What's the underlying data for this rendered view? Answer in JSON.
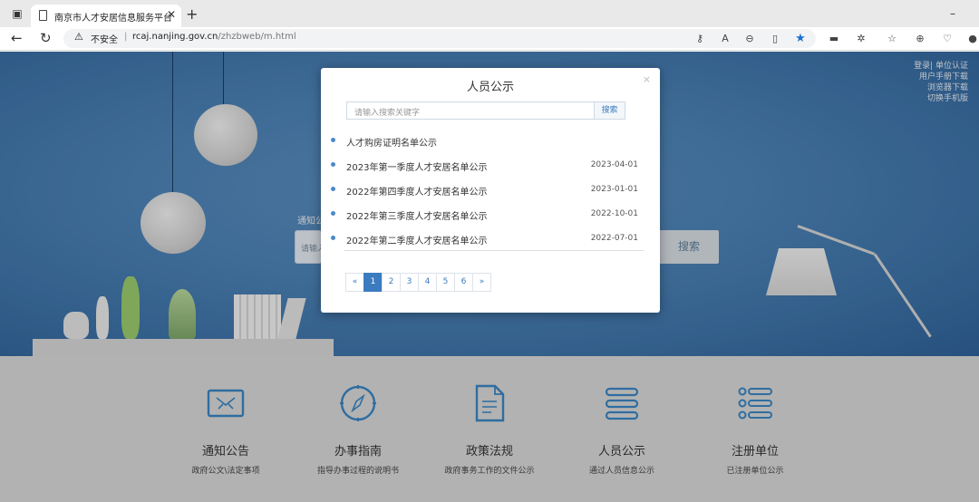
{
  "browser": {
    "tab_title": "南京市人才安居信息服务平台",
    "new_tab": "+",
    "security_label": "不安全",
    "url_host": "rcaj.nanjing.gov.cn",
    "url_path": "/zhzbweb/m.html",
    "separator": "|"
  },
  "top_links": [
    "登录| 单位认证",
    "用户手册下载",
    "浏览器下载",
    "切换手机版"
  ],
  "hero": {
    "search_hint": "通知公",
    "search_placeholder": "请输入",
    "search_button": "搜索"
  },
  "modal": {
    "title": "人员公示",
    "close": "×",
    "search_placeholder": "请输入搜索关键字",
    "search_button": "搜索",
    "items": [
      {
        "title": "人才购房证明名单公示",
        "date": ""
      },
      {
        "title": "2023年第一季度人才安居名单公示",
        "date": "2023-04-01"
      },
      {
        "title": "2022年第四季度人才安居名单公示",
        "date": "2023-01-01"
      },
      {
        "title": "2022年第三季度人才安居名单公示",
        "date": "2022-10-01"
      },
      {
        "title": "2022年第二季度人才安居名单公示",
        "date": "2022-07-01"
      }
    ],
    "pager": {
      "prev": "«",
      "pages": [
        "1",
        "2",
        "3",
        "4",
        "5",
        "6"
      ],
      "next": "»",
      "current": "1"
    }
  },
  "features": [
    {
      "name": "通知公告",
      "desc": "政府公文\\法定事项",
      "icon": "mail-icon"
    },
    {
      "name": "办事指南",
      "desc": "指导办事过程的说明书",
      "icon": "compass-icon"
    },
    {
      "name": "政策法规",
      "desc": "政府事务工作的文件公示",
      "icon": "document-icon"
    },
    {
      "name": "人员公示",
      "desc": "通过人员信息公示",
      "icon": "list-bars-icon"
    },
    {
      "name": "注册单位",
      "desc": "已注册单位公示",
      "icon": "bullet-list-icon"
    }
  ],
  "colors": {
    "accent": "#3b7bbf",
    "icon": "#3a86c4",
    "hero": "#4d84b8",
    "bottom_band": "#d9d9d9"
  }
}
